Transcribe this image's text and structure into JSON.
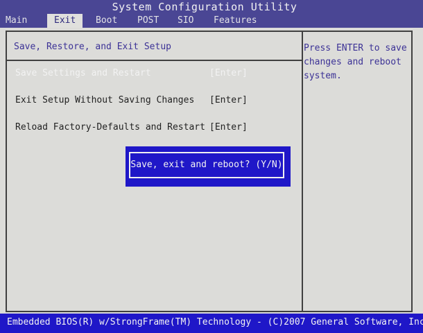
{
  "window": {
    "title": "System Configuration Utility"
  },
  "tabs": [
    {
      "label": "Main",
      "active": false
    },
    {
      "label": "Exit",
      "active": true
    },
    {
      "label": "Boot",
      "active": false
    },
    {
      "label": "POST",
      "active": false
    },
    {
      "label": "SIO",
      "active": false
    },
    {
      "label": "Features",
      "active": false
    }
  ],
  "section": {
    "title": "Save, Restore, and Exit Setup"
  },
  "menu": [
    {
      "label": "Save Settings and Restart",
      "key": "[Enter]",
      "selected": true
    },
    {
      "label": "Exit Setup Without Saving Changes",
      "key": "[Enter]",
      "selected": false
    },
    {
      "label": "Reload Factory-Defaults and Restart",
      "key": "[Enter]",
      "selected": false
    }
  ],
  "help": {
    "text": "Press ENTER to save\nchanges and reboot\nsystem."
  },
  "dialog": {
    "prompt": "Save, exit and reboot? (Y/N)"
  },
  "status": {
    "text": "Embedded BIOS(R) w/StrongFrame(TM) Technology - (C)2007 General Software, Inc"
  },
  "colors": {
    "title_bar": "#4a4694",
    "highlight": "#1f17c8",
    "background": "#dcdcd9",
    "accent_text": "#3c3296"
  }
}
